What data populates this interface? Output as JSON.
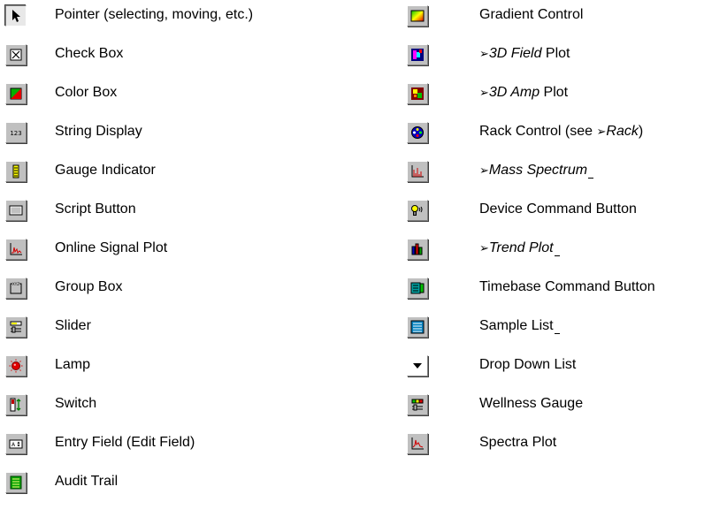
{
  "left_items": [
    {
      "label": "Pointer (selecting, moving, etc.)",
      "icon": "pointer-icon"
    },
    {
      "label": "Check Box",
      "icon": "check-box-icon"
    },
    {
      "label": "Color Box",
      "icon": "color-box-icon"
    },
    {
      "label": "String Display",
      "icon": "string-display-icon"
    },
    {
      "label": "Gauge Indicator",
      "icon": "gauge-indicator-icon"
    },
    {
      "label": "Script Button",
      "icon": "script-button-icon"
    },
    {
      "label": "Online Signal Plot",
      "icon": "online-signal-plot-icon"
    },
    {
      "label": "Group Box",
      "icon": "group-box-icon"
    },
    {
      "label": "Slider",
      "icon": "slider-icon"
    },
    {
      "label": "Lamp",
      "icon": "lamp-icon"
    },
    {
      "label": "Switch",
      "icon": "switch-icon"
    },
    {
      "label": "Entry Field (Edit Field)",
      "icon": "entry-field-icon"
    },
    {
      "label": "Audit Trail",
      "icon": "audit-trail-icon"
    }
  ],
  "right_items": {
    "gradient": {
      "label": "Gradient Control",
      "icon": "gradient-control-icon"
    },
    "field3d": {
      "arrow": "➢",
      "italic": "3D Field",
      "suffix": " Plot",
      "icon": "3d-field-plot-icon"
    },
    "amp3d": {
      "arrow": "➢",
      "italic": "3D Amp",
      "suffix": " Plot",
      "icon": "3d-amp-plot-icon"
    },
    "rack": {
      "prefix": "Rack Control (see ",
      "arrow": "➢",
      "italic": "Rack",
      "suffix": ")",
      "icon": "rack-control-icon"
    },
    "mass": {
      "arrow": "➢",
      "italic": "Mass Spectrum",
      "icon": "mass-spectrum-icon"
    },
    "device": {
      "label": "Device Command Button",
      "icon": "device-command-button-icon"
    },
    "trend": {
      "arrow": "➢",
      "italic": "Trend Plot",
      "icon": "trend-plot-icon"
    },
    "timebase": {
      "label": "Timebase Command Button",
      "icon": "timebase-command-button-icon"
    },
    "sample": {
      "label": "Sample List",
      "icon": "sample-list-icon"
    },
    "dropdown": {
      "label": "Drop Down List",
      "icon": "drop-down-list-icon"
    },
    "wellness": {
      "label": "Wellness Gauge",
      "icon": "wellness-gauge-icon"
    },
    "spectra": {
      "label": "Spectra Plot",
      "icon": "spectra-plot-icon"
    }
  }
}
